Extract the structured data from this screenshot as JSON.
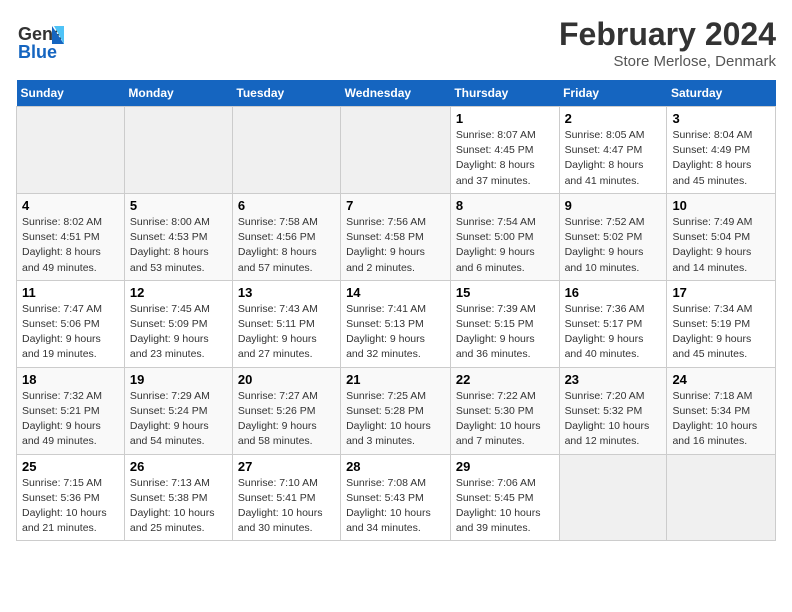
{
  "header": {
    "logo_general": "General",
    "logo_blue": "Blue",
    "title": "February 2024",
    "subtitle": "Store Merlose, Denmark"
  },
  "weekdays": [
    "Sunday",
    "Monday",
    "Tuesday",
    "Wednesday",
    "Thursday",
    "Friday",
    "Saturday"
  ],
  "weeks": [
    [
      {
        "day": "",
        "info": ""
      },
      {
        "day": "",
        "info": ""
      },
      {
        "day": "",
        "info": ""
      },
      {
        "day": "",
        "info": ""
      },
      {
        "day": "1",
        "info": "Sunrise: 8:07 AM\nSunset: 4:45 PM\nDaylight: 8 hours\nand 37 minutes."
      },
      {
        "day": "2",
        "info": "Sunrise: 8:05 AM\nSunset: 4:47 PM\nDaylight: 8 hours\nand 41 minutes."
      },
      {
        "day": "3",
        "info": "Sunrise: 8:04 AM\nSunset: 4:49 PM\nDaylight: 8 hours\nand 45 minutes."
      }
    ],
    [
      {
        "day": "4",
        "info": "Sunrise: 8:02 AM\nSunset: 4:51 PM\nDaylight: 8 hours\nand 49 minutes."
      },
      {
        "day": "5",
        "info": "Sunrise: 8:00 AM\nSunset: 4:53 PM\nDaylight: 8 hours\nand 53 minutes."
      },
      {
        "day": "6",
        "info": "Sunrise: 7:58 AM\nSunset: 4:56 PM\nDaylight: 8 hours\nand 57 minutes."
      },
      {
        "day": "7",
        "info": "Sunrise: 7:56 AM\nSunset: 4:58 PM\nDaylight: 9 hours\nand 2 minutes."
      },
      {
        "day": "8",
        "info": "Sunrise: 7:54 AM\nSunset: 5:00 PM\nDaylight: 9 hours\nand 6 minutes."
      },
      {
        "day": "9",
        "info": "Sunrise: 7:52 AM\nSunset: 5:02 PM\nDaylight: 9 hours\nand 10 minutes."
      },
      {
        "day": "10",
        "info": "Sunrise: 7:49 AM\nSunset: 5:04 PM\nDaylight: 9 hours\nand 14 minutes."
      }
    ],
    [
      {
        "day": "11",
        "info": "Sunrise: 7:47 AM\nSunset: 5:06 PM\nDaylight: 9 hours\nand 19 minutes."
      },
      {
        "day": "12",
        "info": "Sunrise: 7:45 AM\nSunset: 5:09 PM\nDaylight: 9 hours\nand 23 minutes."
      },
      {
        "day": "13",
        "info": "Sunrise: 7:43 AM\nSunset: 5:11 PM\nDaylight: 9 hours\nand 27 minutes."
      },
      {
        "day": "14",
        "info": "Sunrise: 7:41 AM\nSunset: 5:13 PM\nDaylight: 9 hours\nand 32 minutes."
      },
      {
        "day": "15",
        "info": "Sunrise: 7:39 AM\nSunset: 5:15 PM\nDaylight: 9 hours\nand 36 minutes."
      },
      {
        "day": "16",
        "info": "Sunrise: 7:36 AM\nSunset: 5:17 PM\nDaylight: 9 hours\nand 40 minutes."
      },
      {
        "day": "17",
        "info": "Sunrise: 7:34 AM\nSunset: 5:19 PM\nDaylight: 9 hours\nand 45 minutes."
      }
    ],
    [
      {
        "day": "18",
        "info": "Sunrise: 7:32 AM\nSunset: 5:21 PM\nDaylight: 9 hours\nand 49 minutes."
      },
      {
        "day": "19",
        "info": "Sunrise: 7:29 AM\nSunset: 5:24 PM\nDaylight: 9 hours\nand 54 minutes."
      },
      {
        "day": "20",
        "info": "Sunrise: 7:27 AM\nSunset: 5:26 PM\nDaylight: 9 hours\nand 58 minutes."
      },
      {
        "day": "21",
        "info": "Sunrise: 7:25 AM\nSunset: 5:28 PM\nDaylight: 10 hours\nand 3 minutes."
      },
      {
        "day": "22",
        "info": "Sunrise: 7:22 AM\nSunset: 5:30 PM\nDaylight: 10 hours\nand 7 minutes."
      },
      {
        "day": "23",
        "info": "Sunrise: 7:20 AM\nSunset: 5:32 PM\nDaylight: 10 hours\nand 12 minutes."
      },
      {
        "day": "24",
        "info": "Sunrise: 7:18 AM\nSunset: 5:34 PM\nDaylight: 10 hours\nand 16 minutes."
      }
    ],
    [
      {
        "day": "25",
        "info": "Sunrise: 7:15 AM\nSunset: 5:36 PM\nDaylight: 10 hours\nand 21 minutes."
      },
      {
        "day": "26",
        "info": "Sunrise: 7:13 AM\nSunset: 5:38 PM\nDaylight: 10 hours\nand 25 minutes."
      },
      {
        "day": "27",
        "info": "Sunrise: 7:10 AM\nSunset: 5:41 PM\nDaylight: 10 hours\nand 30 minutes."
      },
      {
        "day": "28",
        "info": "Sunrise: 7:08 AM\nSunset: 5:43 PM\nDaylight: 10 hours\nand 34 minutes."
      },
      {
        "day": "29",
        "info": "Sunrise: 7:06 AM\nSunset: 5:45 PM\nDaylight: 10 hours\nand 39 minutes."
      },
      {
        "day": "",
        "info": ""
      },
      {
        "day": "",
        "info": ""
      }
    ]
  ]
}
